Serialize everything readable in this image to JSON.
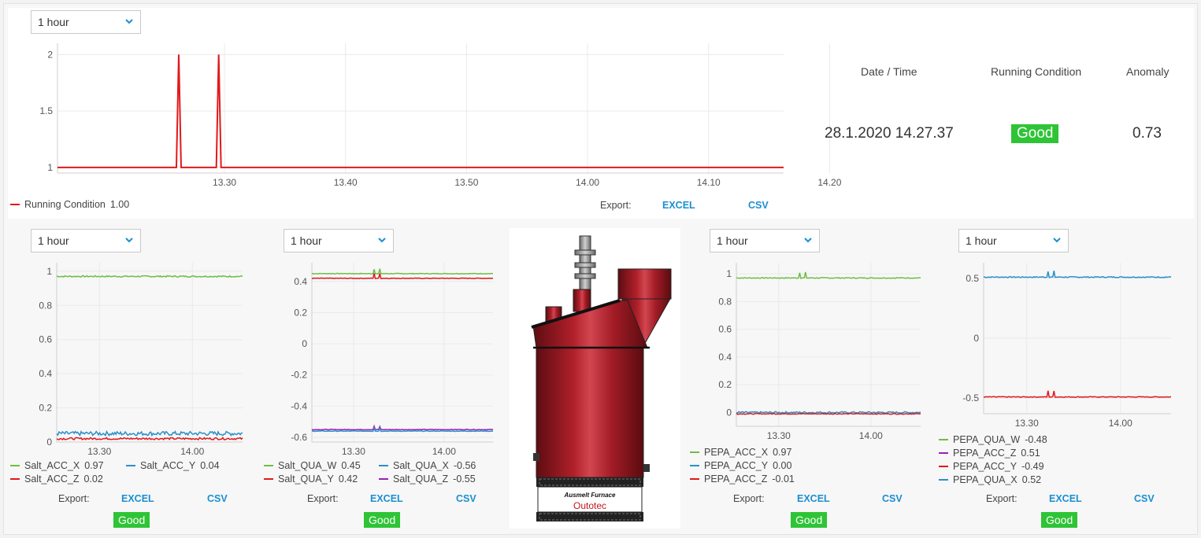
{
  "colors": {
    "red": "#e0191b",
    "green": "#6cbf43",
    "blue": "#2a90c9",
    "purple": "#9b1fb8",
    "cyan": "#1aa3c4",
    "badge": "#2ec436",
    "link": "#1a8fd1"
  },
  "top": {
    "range_select": "1 hour",
    "legend": {
      "name": "Running Condition",
      "value": "1.00"
    },
    "export_label": "Export:",
    "excel": "EXCEL",
    "csv": "CSV",
    "summary": {
      "headers": [
        "Date / Time",
        "Running Condition",
        "Anomaly"
      ],
      "datetime": "28.1.2020 14.27.37",
      "condition": "Good",
      "anomaly": "0.73"
    }
  },
  "panels": [
    {
      "range_select": "1 hour",
      "legend": [
        {
          "name": "Salt_ACC_X",
          "value": "0.97",
          "color": "#6cbf43"
        },
        {
          "name": "Salt_ACC_Y",
          "value": "0.04",
          "color": "#2a90c9"
        },
        {
          "name": "Salt_ACC_Z",
          "value": "0.02",
          "color": "#e0191b"
        }
      ],
      "export_label": "Export:",
      "excel": "EXCEL",
      "csv": "CSV",
      "status": "Good"
    },
    {
      "range_select": "1 hour",
      "legend": [
        {
          "name": "Salt_QUA_W",
          "value": "0.45",
          "color": "#6cbf43"
        },
        {
          "name": "Salt_QUA_X",
          "value": "-0.56",
          "color": "#2a90c9"
        },
        {
          "name": "Salt_QUA_Y",
          "value": "0.42",
          "color": "#e0191b"
        },
        {
          "name": "Salt_QUA_Z",
          "value": "-0.55",
          "color": "#9b1fb8"
        }
      ],
      "export_label": "Export:",
      "excel": "EXCEL",
      "csv": "CSV",
      "status": "Good"
    },
    {
      "range_select": "1 hour",
      "legend": [
        {
          "name": "PEPA_ACC_X",
          "value": "0.97",
          "color": "#6cbf43"
        },
        {
          "name": "PEPA_ACC_Y",
          "value": "0.00",
          "color": "#2a90c9"
        },
        {
          "name": "PEPA_ACC_Z",
          "value": "-0.01",
          "color": "#e0191b"
        }
      ],
      "export_label": "Export:",
      "excel": "EXCEL",
      "csv": "CSV",
      "status": "Good"
    },
    {
      "range_select": "1 hour",
      "legend": [
        {
          "name": "PEPA_QUA_W",
          "value": "-0.48",
          "color": "#6cbf43"
        },
        {
          "name": "PEPA_ACC_Z",
          "value": "0.51",
          "color": "#9b1fb8"
        },
        {
          "name": "PEPA_ACC_Y",
          "value": "-0.49",
          "color": "#e0191b"
        },
        {
          "name": "PEPA_QUA_X",
          "value": "0.52",
          "color": "#2a90c9"
        }
      ],
      "export_label": "Export:",
      "excel": "EXCEL",
      "csv": "CSV",
      "status": "Good"
    }
  ],
  "furnace": {
    "label": "Ausmelt Furnace",
    "brand": "Outotec"
  },
  "chart_data": [
    {
      "type": "line",
      "x_ticks": [
        "13.30",
        "13.40",
        "13.50",
        "14.00",
        "14.10",
        "14.20"
      ],
      "y_ticks": [
        1,
        1.5,
        2
      ],
      "ylim": [
        0.95,
        2.1
      ],
      "xlim": [
        13.27,
        14.27
      ],
      "series": [
        {
          "name": "Running Condition",
          "color": "#e0191b",
          "baseline": 1,
          "spikes": [
            {
              "x": 13.437,
              "y": 2
            },
            {
              "x": 13.492,
              "y": 2
            }
          ]
        }
      ]
    },
    {
      "type": "line",
      "x_ticks": [
        "13.30",
        "14.00"
      ],
      "y_ticks": [
        0,
        0.2,
        0.4,
        0.6,
        0.8,
        1
      ],
      "ylim": [
        0,
        1.05
      ],
      "xlim": [
        13.27,
        14.27
      ],
      "series": [
        {
          "name": "Salt_ACC_X",
          "color": "#6cbf43",
          "level": 0.97,
          "noise": 0.004
        },
        {
          "name": "Salt_ACC_Y",
          "color": "#2a90c9",
          "level": 0.05,
          "noise": 0.012
        },
        {
          "name": "Salt_ACC_Z",
          "color": "#e0191b",
          "level": 0.02,
          "noise": 0.006
        }
      ]
    },
    {
      "type": "line",
      "x_ticks": [
        "13.30",
        "14.00"
      ],
      "y_ticks": [
        -0.6,
        -0.4,
        -0.2,
        0,
        0.2,
        0.4
      ],
      "ylim": [
        -0.63,
        0.52
      ],
      "xlim": [
        13.27,
        14.27
      ],
      "series": [
        {
          "name": "Salt_QUA_W",
          "color": "#6cbf43",
          "level": 0.45,
          "noise": 0.002,
          "bump": 0.03
        },
        {
          "name": "Salt_QUA_Y",
          "color": "#e0191b",
          "level": 0.42,
          "noise": 0.002,
          "bump": 0.03
        },
        {
          "name": "Salt_QUA_Z",
          "color": "#9b1fb8",
          "level": -0.55,
          "noise": 0.002,
          "bump": 0.02
        },
        {
          "name": "Salt_QUA_X",
          "color": "#2a90c9",
          "level": -0.56,
          "noise": 0.002,
          "bump": 0.02
        }
      ]
    },
    {
      "type": "line",
      "x_ticks": [
        "13.30",
        "14.00"
      ],
      "y_ticks": [
        0,
        0.2,
        0.4,
        0.6,
        0.8,
        1
      ],
      "ylim": [
        -0.1,
        1.08
      ],
      "xlim": [
        13.27,
        14.27
      ],
      "series": [
        {
          "name": "PEPA_ACC_X",
          "color": "#6cbf43",
          "level": 0.97,
          "noise": 0.003,
          "bump": 0.04
        },
        {
          "name": "PEPA_ACC_Y",
          "color": "#2a90c9",
          "level": 0.0,
          "noise": 0.006
        },
        {
          "name": "PEPA_ACC_Z",
          "color": "#e0191b",
          "level": -0.01,
          "noise": 0.003
        }
      ]
    },
    {
      "type": "line",
      "x_ticks": [
        "13.30",
        "14.00"
      ],
      "y_ticks": [
        -0.5,
        0,
        0.5
      ],
      "ylim": [
        -0.63,
        0.63
      ],
      "xlim": [
        13.27,
        14.27
      ],
      "series": [
        {
          "name": "PEPA_QUA_X",
          "color": "#2a90c9",
          "level": 0.51,
          "noise": 0.004,
          "bump": 0.05
        },
        {
          "name": "PEPA_ACC_Y",
          "color": "#e0191b",
          "level": -0.49,
          "noise": 0.003,
          "bump": 0.05
        }
      ]
    }
  ]
}
